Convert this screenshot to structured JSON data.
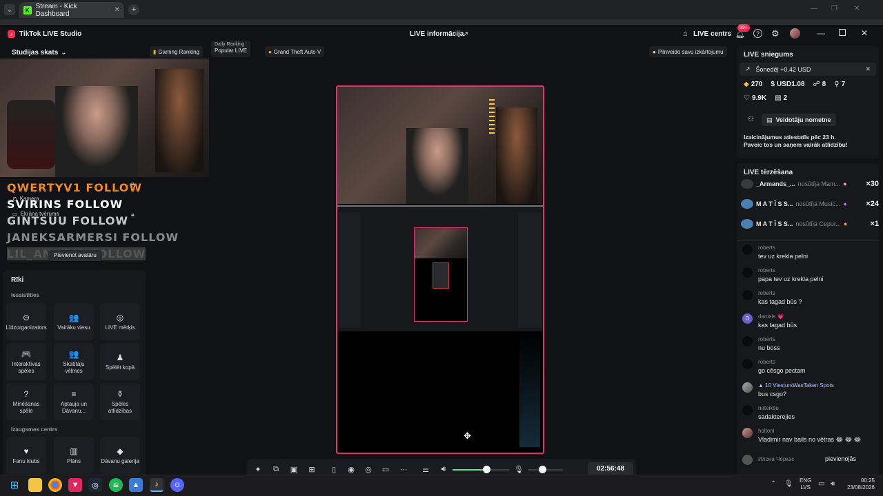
{
  "browser": {
    "tab_title": "Stream - Kick Dashboard",
    "new_tab_label": "+",
    "minimize": "—",
    "restore": "❐",
    "close": "✕"
  },
  "app": {
    "name": "TikTok LIVE Studio",
    "center_title": "LIVE informācija",
    "live_center_label": "LIVE centrs",
    "notif_badge": "99+"
  },
  "left": {
    "studio_view_label": "Studijas skats",
    "source_camera": "Kamera",
    "source_screen": "Ekrāna tvērums",
    "add_avatar_tooltip": "Pievienot avatāru",
    "tools_title": "Rīki",
    "related_title": "Iesaistīties",
    "growth_title": "Izaugsmes centrs",
    "tiles": [
      {
        "label": "Līdzorganizators",
        "icon": "⊝"
      },
      {
        "label": "Vairāku viesu",
        "icon": "👥"
      },
      {
        "label": "LIVE mērķis",
        "icon": "◎"
      },
      {
        "label": "Interaktīvas spēles",
        "icon": "🎮"
      },
      {
        "label": "Skatītāju vēlmes",
        "icon": "👥"
      },
      {
        "label": "Spēlēt kopā",
        "icon": "♟"
      },
      {
        "label": "Minēšanas spēle",
        "icon": "?"
      },
      {
        "label": "Aptauja un Dāvanu...",
        "icon": "≡"
      },
      {
        "label": "Spēles atlīdzības",
        "icon": "⚱"
      },
      {
        "label": "Fanu klubs",
        "icon": "♥"
      },
      {
        "label": "Plāns",
        "icon": "▥"
      },
      {
        "label": "Dāvanu galerija",
        "icon": "◆"
      }
    ],
    "followers": [
      "QWERTYV1 FOLLOW",
      "SVIRINS FOLLOW",
      "GINTSUU FOLLOW",
      "JANEKSARMERSI FOLLOW",
      "LIL_ANDRIS FOLLOW"
    ]
  },
  "chips": {
    "gaming_ranking": "Gaming Ranking",
    "daily_ranking": "Daily Ranking",
    "popular_live": "Popular LIVE",
    "game": "Grand Theft Auto V",
    "improve_hint": "Pilnveido savu izkārtojumu"
  },
  "bottom_toolbar": {
    "timer": "02:56:48",
    "volume_level": 0.6,
    "mic_level": 0.3
  },
  "right": {
    "live_achievements_title": "LIVE sniegums",
    "today_banner": "Šonedēļ +0.42 USD",
    "stats": {
      "diamonds": "270",
      "usd": "USD1.08",
      "viewers": "8",
      "new_followers": "7",
      "likes": "9.9K",
      "gifts": "2"
    },
    "creator_drop_label": "Veidotāju nometne",
    "challenge_text_1": "Izaicinājumus atiestatīs pēc 23 h.",
    "challenge_text_2": "Paveic tos un saņem vairāk atlīdzību!",
    "chat_title": "LIVE tērzēšana",
    "gifts": [
      {
        "name": "_Armands_...",
        "action": "nosūtīja Mam...",
        "count": "×30",
        "avatar_color": "#3a3a3a"
      },
      {
        "name": "M A T Ī S S...",
        "action": "nosūtīja Music...",
        "count": "×24",
        "avatar_color": "#4a7fb0"
      },
      {
        "name": "M A T Ī S S...",
        "action": "nosūtīja Cepur...",
        "count": "×1",
        "avatar_color": "#4a7fb0"
      }
    ],
    "messages": [
      {
        "user": "roberts",
        "text": "tev uz krekla pelni"
      },
      {
        "user": "roberts",
        "text": "papa tev uz krekla pelni"
      },
      {
        "user": "roberts",
        "text": "kas tagad būs ?"
      },
      {
        "user": "daniels 💗",
        "text": "kas tagad būs"
      },
      {
        "user": "roberts",
        "text": "nu boss"
      },
      {
        "user": "roberts",
        "text": "go cēsgo pectam"
      },
      {
        "user": "▲ 10  ViestursWasTaken Spots",
        "text": "bus csgo?"
      },
      {
        "user": "neteikšu",
        "text": "sadakterejies"
      },
      {
        "user": "holtoni",
        "text": "Vladimir nav bails no vētras 😂 😂 😂"
      },
      {
        "user": "Илона Черкас",
        "text": "pievienojās"
      }
    ]
  },
  "taskbar": {
    "lang_top": "ENG",
    "lang_bottom": "LVS",
    "time": "00:25",
    "date": "23/08/2026"
  }
}
